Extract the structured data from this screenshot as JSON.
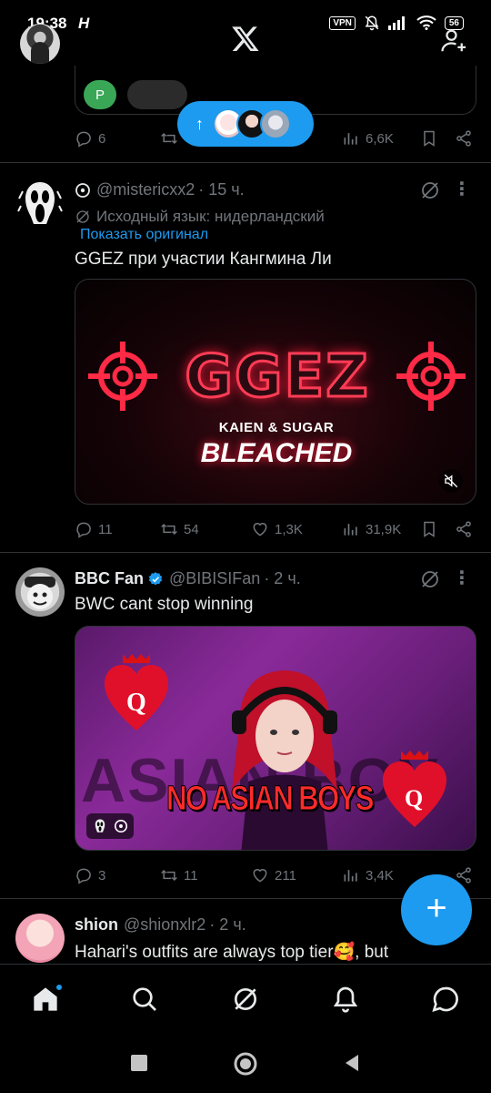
{
  "status_bar": {
    "time": "19:38",
    "extra": "H",
    "vpn": "VPN",
    "battery": "56"
  },
  "colors": {
    "accent": "#1d9bf0",
    "background": "#000000",
    "muted": "#71767b",
    "text": "#e7e9ea"
  },
  "header": {
    "logo": "X",
    "follow_icon": "add-user-icon"
  },
  "new_posts_pill": {
    "arrow": "↑"
  },
  "prev_tweet": {
    "poll_chip": "P",
    "replies": "6",
    "views": "6,6K"
  },
  "tweets": [
    {
      "name": "",
      "handle": "@mistericxx2",
      "time": "· 15 ч.",
      "translation_note": "Исходный язык: нидерландский",
      "show_original": "Показать оригинал",
      "text": "GGEZ при участии Кангмина Ли",
      "media": {
        "title": "GGEZ",
        "subtitle_left": "KAIEN",
        "subtitle_amp": "&",
        "subtitle_right": "SUGAR",
        "tagline": "BLEACHED"
      },
      "replies": "11",
      "reposts": "54",
      "likes": "1,3K",
      "views": "31,9K"
    },
    {
      "name": "BBC Fan",
      "verified": true,
      "handle": "@BIBISIFan",
      "time": "· 2 ч.",
      "text": "BWC cant stop winning",
      "media": {
        "overlay_text": "NO ASIAN BOYS",
        "background_text": "ASIAN BOY",
        "card_letter": "Q"
      },
      "replies": "3",
      "reposts": "11",
      "likes": "211",
      "views": "3,4K"
    },
    {
      "name": "shion",
      "handle": "@shionxlr2",
      "time": "· 2 ч.",
      "text": "Hahari's outfits are always top tier🥰, but"
    }
  ],
  "fab": {
    "label": "+"
  },
  "bottom_nav": [
    "home-icon",
    "search-icon",
    "grok-icon",
    "notifications-icon",
    "messages-icon"
  ]
}
